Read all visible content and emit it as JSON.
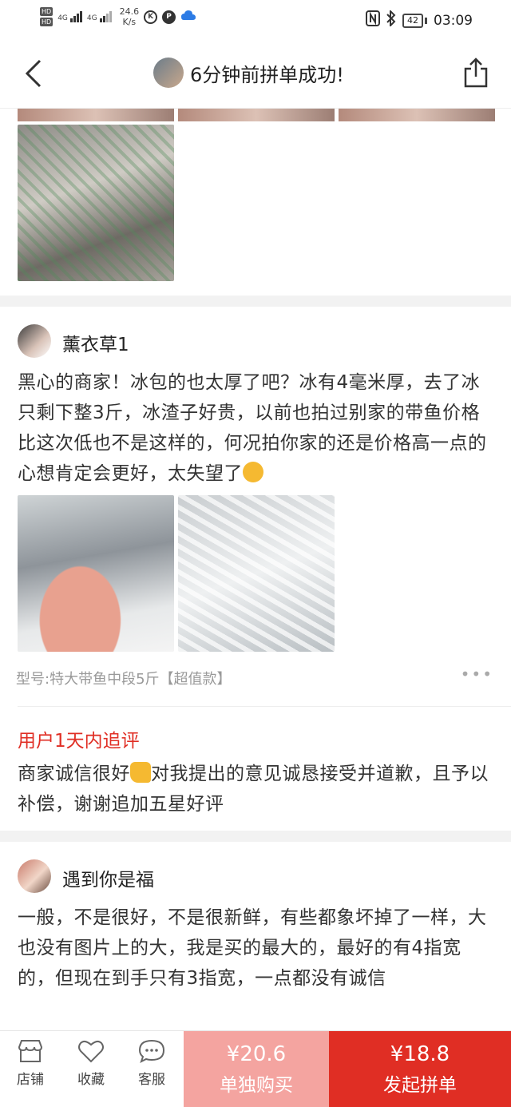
{
  "status_bar": {
    "hd1": "HD",
    "hd2": "HD",
    "net1": "4G",
    "net2": "4G",
    "speed_value": "24.6",
    "speed_unit": "K/s",
    "battery": "42",
    "time": "03:09"
  },
  "header": {
    "title": "6分钟前拼单成功!"
  },
  "reviews": [
    {
      "username": "薰衣草1",
      "text": "黑心的商家！冰包的也太厚了吧？冰有4毫米厚，去了冰只剩下整3斤，冰渣子好贵，以前也拍过别家的带鱼价格比这次低也不是这样的，何况拍你家的还是价格高一点的心想肯定会更好，太失望了",
      "model": "型号:特大带鱼中段5斤【超值款】",
      "followup_title": "用户1天内追评",
      "followup_text_1": "商家诚信很好",
      "followup_text_2": "对我提出的意见诚恳接受并道歉，且予以补偿，谢谢追加五星好评"
    },
    {
      "username": "遇到你是福",
      "text": "一般，不是很好，不是很新鲜，有些都象坏掉了一样，大也没有图片上的大，我是买的最大的，最好的有4指宽的，但现在到手只有3指宽，一点都没有诚信"
    }
  ],
  "bottom_bar": {
    "shop_label": "店铺",
    "favorite_label": "收藏",
    "service_label": "客服",
    "alone_price": "¥20.6",
    "alone_label": "单独购买",
    "group_price": "¥18.8",
    "group_label": "发起拼单"
  },
  "colors": {
    "accent": "#e02e24",
    "alone_bg": "#f4a4a0"
  }
}
